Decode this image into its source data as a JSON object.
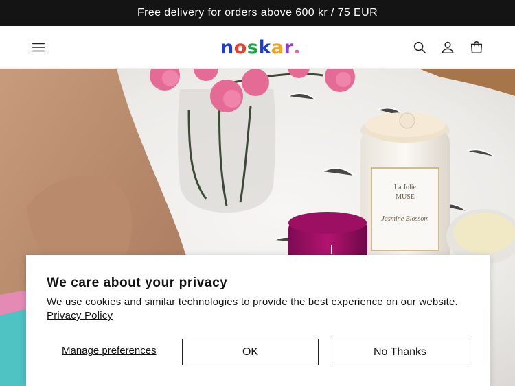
{
  "announcement": {
    "text": "Free delivery for orders above 600 kr / 75 EUR"
  },
  "header": {
    "logo_letters": [
      {
        "char": "n",
        "color": "#1f3fc8"
      },
      {
        "char": "o",
        "color": "#e8402f"
      },
      {
        "char": "s",
        "color": "#1fa34a"
      },
      {
        "char": "k",
        "color": "#1f3fc8"
      },
      {
        "char": "a",
        "color": "#f2a51f"
      },
      {
        "char": "r",
        "color": "#8b3fc8"
      },
      {
        "char": ".",
        "color": "#ff5e8a"
      }
    ],
    "icons": {
      "menu": "menu-icon",
      "search": "search-icon",
      "account": "account-icon",
      "cart": "cart-icon"
    }
  },
  "hero": {
    "candle_label_line1": "La Jolie",
    "candle_label_line2": "MUSE",
    "candle_label_script": "Jasmine Blossom"
  },
  "cookie_banner": {
    "title": "We care about your privacy",
    "body": "We use cookies and similar technologies to provide the best experience on our website.",
    "policy_link": "Privacy Policy",
    "manage_label": "Manage preferences",
    "ok_label": "OK",
    "no_thanks_label": "No Thanks"
  }
}
